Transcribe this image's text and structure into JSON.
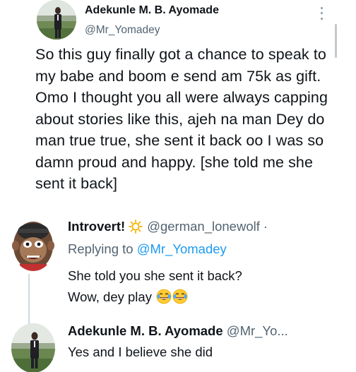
{
  "main_tweet": {
    "author_name": "Adekunle M. B. Ayomade",
    "author_handle": "@Mr_Yomadey",
    "text": "So this guy finally got a chance to speak to my babe and boom e send am 75k as gift. Omo I thought you all were always capping about stories like this, ajeh na man Dey do man true true, she sent it back oo I was so damn proud and happy. [she told me she sent it back]"
  },
  "reply_1": {
    "author_name": "Introvert!",
    "author_handle": "@german_lonewolf",
    "separator": "·",
    "replying_prefix": "Replying to",
    "replying_mention": "@Mr_Yomadey",
    "text_line1": "She told you she sent it back?",
    "text_line2": "Wow, dey play",
    "name_emoji": "sun-icon",
    "trailing_emoji": "laughing-tears-icon"
  },
  "reply_2": {
    "author_name": "Adekunle M. B. Ayomade",
    "author_handle": "@Mr_Yo...",
    "text": "Yes and I believe she did"
  },
  "colors": {
    "text_primary": "#0f1419",
    "text_secondary": "#536471",
    "link": "#1d9bf0",
    "thread_line": "#cfd9de"
  }
}
